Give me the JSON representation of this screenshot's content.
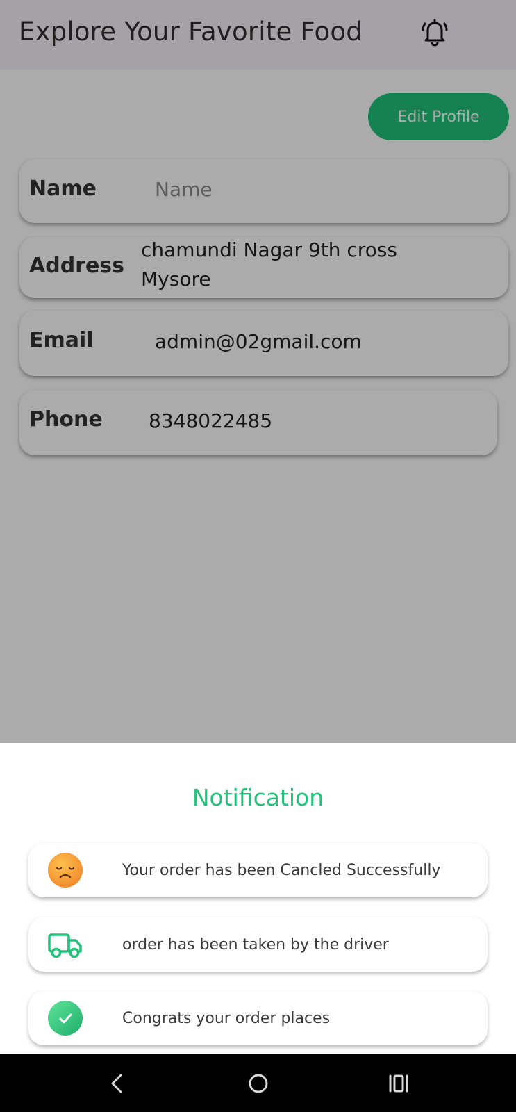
{
  "header": {
    "title": "Explore Your Favorite Food",
    "bell_icon": "bell-icon"
  },
  "profile": {
    "edit_button_label": "Edit Profile",
    "fields": [
      {
        "label": "Name",
        "value": "",
        "placeholder": "Name"
      },
      {
        "label": "Address",
        "value_line1": "chamundi Nagar 9th cross",
        "value_line2": "Mysore"
      },
      {
        "label": "Email",
        "value": "admin@02gmail.com"
      },
      {
        "label": "Phone",
        "value": "8348022485"
      }
    ]
  },
  "notification_sheet": {
    "title": "Notification",
    "items": [
      {
        "icon": "sad-face-icon",
        "text": "Your order has been Cancled Successfully"
      },
      {
        "icon": "delivery-truck-icon",
        "text": "order has been taken by the driver"
      },
      {
        "icon": "check-circle-icon",
        "text": "Congrats your order places"
      }
    ]
  },
  "navbar": {
    "back_icon": "back-icon",
    "home_icon": "home-icon",
    "recents_icon": "recents-icon"
  },
  "colors": {
    "accent": "#22c27a",
    "scrim": "rgba(0,0,0,0.33)",
    "navbar": "#000000",
    "sad_face": "#f39a3a"
  }
}
